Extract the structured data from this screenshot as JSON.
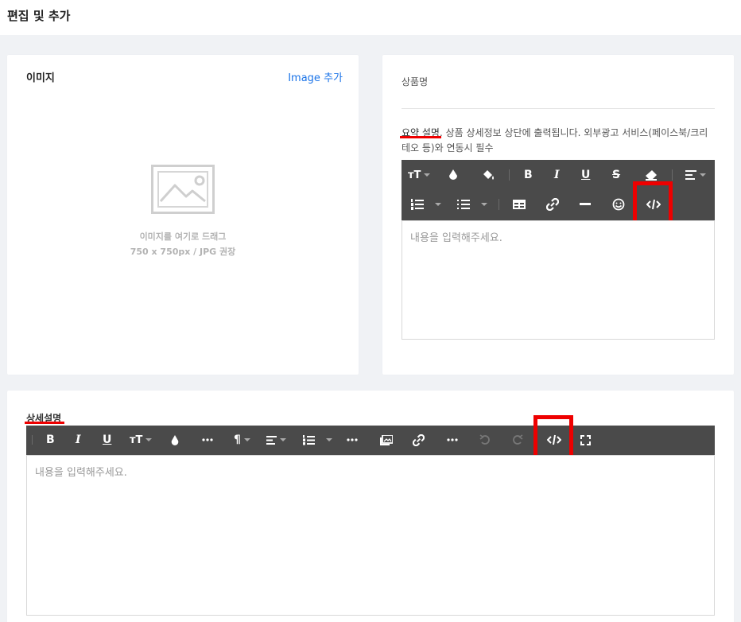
{
  "header": {
    "title": "편집 및 추가"
  },
  "image_card": {
    "title": "이미지",
    "add_label": "Image 추가",
    "hint_line1": "이미지를 여기로 드래그",
    "hint_line2": "750 x 750px / JPG 권장"
  },
  "product_card": {
    "name_label": "상품명",
    "summary_underlined": "요약 설명",
    "summary_rest": ". 상품 상세정보 상단에 출력됩니다. 외부광고 서비스(페이스북/크리테오 등)와 연동시 필수",
    "editor_placeholder": "내용을 입력해주세요."
  },
  "detail_card": {
    "label": "상세설명",
    "editor_placeholder": "내용을 입력해주세요."
  },
  "colors": {
    "accent_link": "#1a73e8",
    "toolbar_bg": "#4a4a4a",
    "highlight": "#e00000"
  }
}
